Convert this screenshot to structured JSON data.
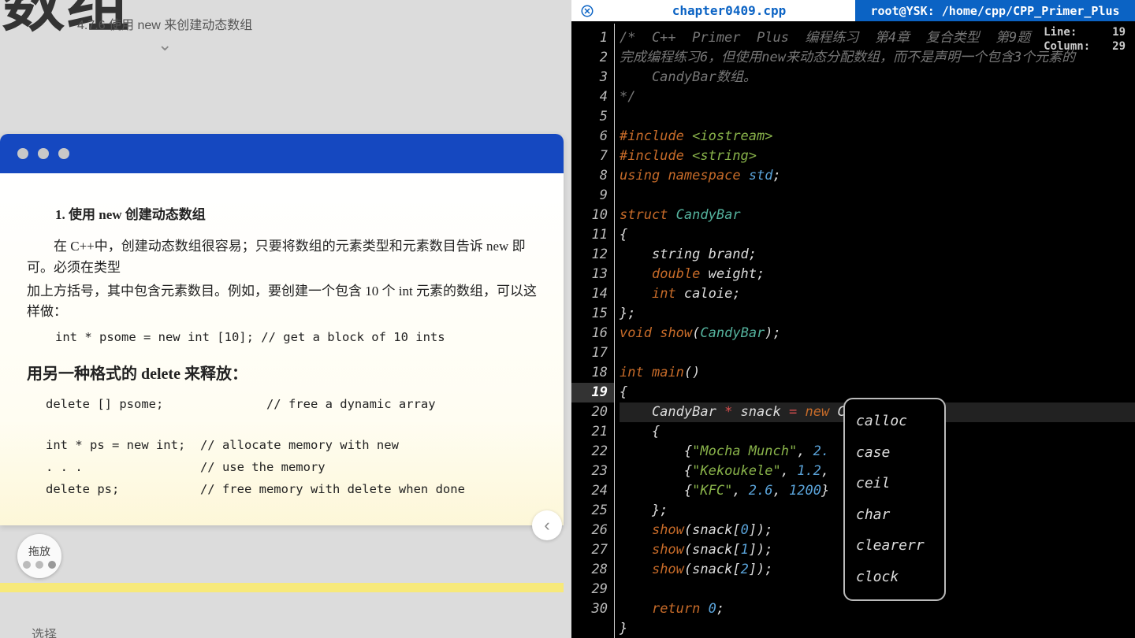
{
  "left": {
    "big_title": "态数组",
    "subtitle": "4.7.6  使用 new 来创建动态数组",
    "card": {
      "h1": "1.  使用 new 创建动态数组",
      "p1": "在 C++中，创建动态数组很容易；只要将数组的元素类型和元素数目告诉 new 即可。必须在类型",
      "p2": "加上方括号，其中包含元素数目。例如，要创建一个包含 10 个 int 元素的数组，可以这样做：",
      "code1": "int * psome = new int [10]; // get a block of 10 ints",
      "release": "用另一种格式的 delete 来释放：",
      "code2": "delete [] psome;              // free a dynamic array",
      "code3": "int * ps = new int;  // allocate memory with new",
      "code4": ". . .                // use the memory",
      "code5": "delete ps;           // free memory with delete when done"
    },
    "drag": "拖放",
    "pick": "选择"
  },
  "right": {
    "tab_file": "chapter0409.cpp",
    "tab_path": "root@YSK: /home/cpp/CPP_Primer_Plus",
    "pos": {
      "line_lbl": "Line:",
      "line_val": "19",
      "col_lbl": "Column:",
      "col_val": "29"
    },
    "gutter_start": 1,
    "gutter_end": 30,
    "cur_line": 19,
    "lines": {
      "l1": "/*  C++  Primer  Plus  编程练习  第4章  复合类型  第9题",
      "l2a": "完成编程练习6，但使用new来动态分配数组，而不是声明一个包含3个元素的",
      "l2b": "    CandyBar数组。",
      "l3": "*/",
      "l19_pre": "    CandyBar ",
      "l19_mid": " snack ",
      "l19_new": " new ",
      "l19_tail": "C"
    },
    "auto": [
      "calloc",
      "case",
      "ceil",
      "char",
      "clearerr",
      "clock"
    ]
  }
}
